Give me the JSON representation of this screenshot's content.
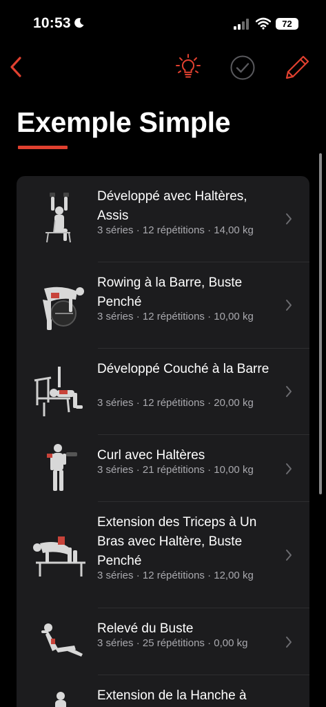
{
  "status": {
    "time": "10:53",
    "battery": "72"
  },
  "toolbar": {
    "back_icon": "chevron-left-icon",
    "hint_icon": "lightbulb-icon",
    "complete_icon": "checkmark-circle-icon",
    "edit_icon": "pencil-icon"
  },
  "colors": {
    "accent": "#e0402f",
    "background": "#000000",
    "card": "#1c1c1e",
    "secondary_text": "#a9a9ae"
  },
  "page": {
    "title": "Exemple Simple"
  },
  "exercises": [
    {
      "name": "Développé avec Haltères, Assis",
      "meta": "3 séries · 12 répétitions · 14,00 kg"
    },
    {
      "name": "Rowing à la Barre, Buste Penché",
      "meta": "3 séries · 12 répétitions · 10,00 kg"
    },
    {
      "name": "Développé Couché à la Barre",
      "meta": "3 séries · 12 répétitions · 20,00 kg"
    },
    {
      "name": "Curl avec Haltères",
      "meta": "3 séries · 21 répétitions · 10,00 kg"
    },
    {
      "name": "Extension des Triceps à Un Bras avec Haltère, Buste Penché",
      "meta": "3 séries · 12 répétitions · 12,00 kg"
    },
    {
      "name": "Relevé du Buste",
      "meta": "3 séries · 25 répétitions · 0,00 kg"
    },
    {
      "name": "Extension de la Hanche à",
      "meta": ""
    }
  ]
}
